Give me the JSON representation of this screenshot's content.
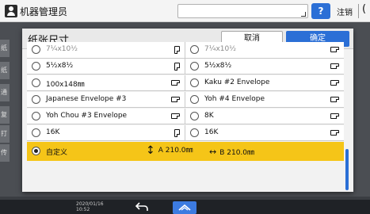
{
  "topbar": {
    "title": "机器管理员",
    "help_label": "?",
    "logout_label": "注销",
    "extra_char": "("
  },
  "background_tabs": [
    "纸",
    "纸",
    "通",
    "复",
    "打",
    "传"
  ],
  "sysbar": {
    "date": "2020/01/16",
    "time": "10:52"
  },
  "dialog": {
    "title": "纸张尺寸",
    "cancel_label": "取消",
    "ok_label": "确定",
    "rows": [
      {
        "left": {
          "label": "7¼x10½",
          "orientation": "portrait",
          "selected": false
        },
        "right": {
          "label": "7¼x10½",
          "orientation": "landscape",
          "selected": false
        }
      },
      {
        "left": {
          "label": "5½x8½",
          "orientation": "portrait",
          "selected": false
        },
        "right": {
          "label": "5½x8½",
          "orientation": "landscape",
          "selected": false
        }
      },
      {
        "left": {
          "label": "100x148㎜",
          "orientation": "landscape",
          "selected": false
        },
        "right": {
          "label": "Kaku #2 Envelope",
          "orientation": "landscape",
          "selected": false
        }
      },
      {
        "left": {
          "label": "Japanese Envelope #3",
          "orientation": "landscape",
          "selected": false
        },
        "right": {
          "label": "Yoh #4 Envelope",
          "orientation": "landscape",
          "selected": false
        }
      },
      {
        "left": {
          "label": "Yoh Chou #3 Envelope",
          "orientation": "landscape",
          "selected": false
        },
        "right": {
          "label": "8K",
          "orientation": "landscape",
          "selected": false
        }
      },
      {
        "left": {
          "label": "16K",
          "orientation": "portrait",
          "selected": false
        },
        "right": {
          "label": "16K",
          "orientation": "landscape",
          "selected": false
        }
      }
    ],
    "custom": {
      "label": "自定义",
      "selected": true,
      "size_a": "A 210.0㎜",
      "size_b": "B 210.0㎜"
    }
  },
  "colors": {
    "accent": "#2b6fd6",
    "highlight": "#f5c518"
  }
}
